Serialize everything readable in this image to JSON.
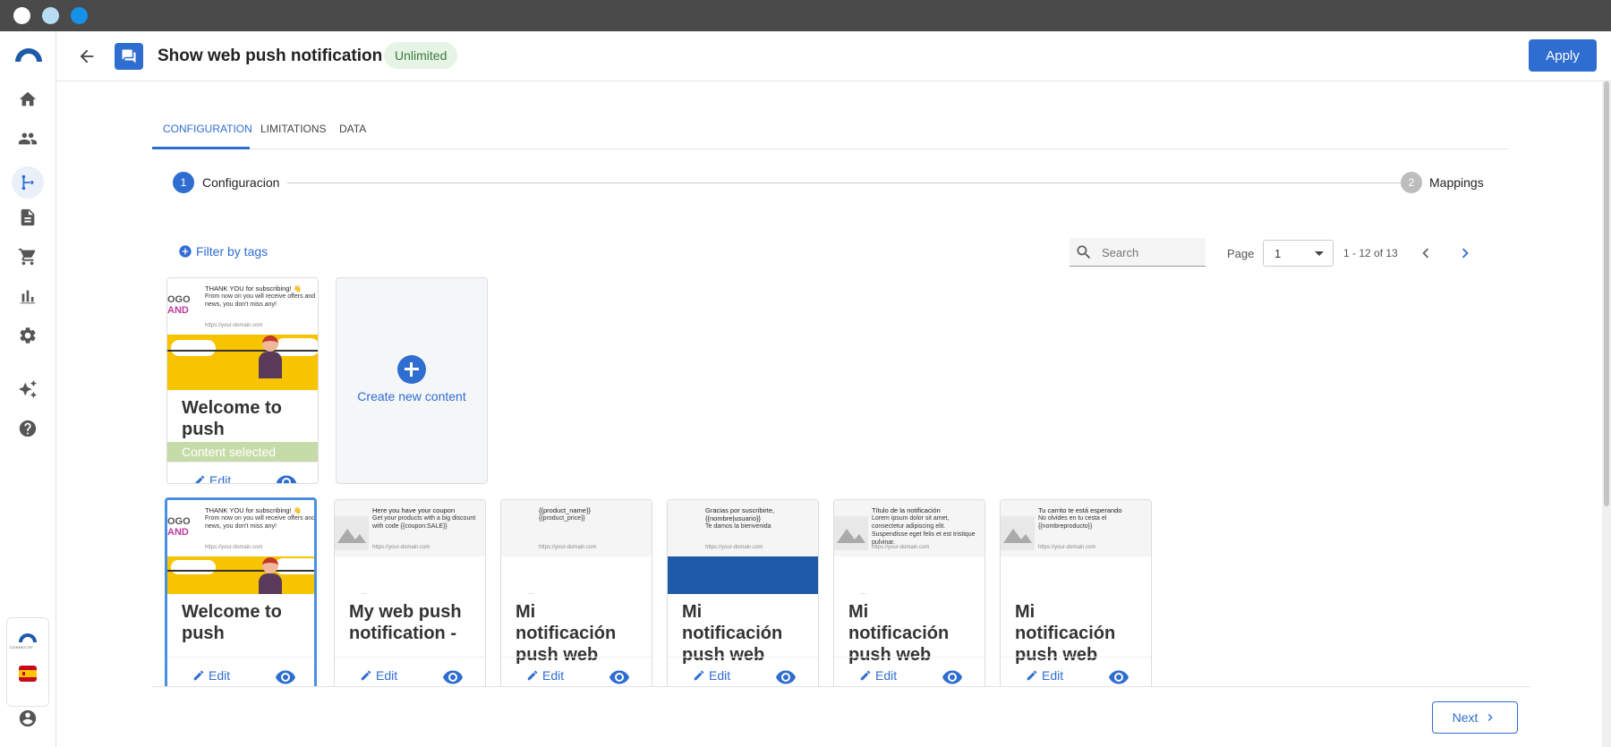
{
  "window": {
    "dots": [
      "#ffffff",
      "#b9dcf5",
      "#1591e8"
    ]
  },
  "sidebar": {
    "items": [
      "home-icon",
      "people-icon",
      "flow-icon",
      "document-icon",
      "cart-icon",
      "chart-icon",
      "gear-icon",
      "sparkle-icon",
      "help-icon"
    ],
    "active": "flow-icon",
    "brand_text": "CONNECTIF",
    "language": "es"
  },
  "header": {
    "title": "Show web push notification",
    "badge": "Unlimited",
    "apply_label": "Apply",
    "accent": "#2f6dd1"
  },
  "tabs": [
    "CONFIGURATION",
    "LIMITATIONS",
    "DATA"
  ],
  "active_tab": "CONFIGURATION",
  "stepper": {
    "steps": [
      {
        "number": "1",
        "label": "Configuracion"
      },
      {
        "number": "2",
        "label": "Mappings"
      }
    ]
  },
  "toolbar": {
    "filter_label": "Filter by tags",
    "search_placeholder": "Search",
    "page_label": "Page",
    "page_value": "1",
    "range": "1 - 12 of 13"
  },
  "selected_card": {
    "title": "Welcome to push",
    "status": "Content selected",
    "edit": "Edit",
    "thumb_title": "THANK YOU for subscribing! 👋",
    "thumb_body": "From now on you will receive offers and news, you don't miss any!",
    "thumb_url": "https://your-domain.com",
    "logo_line1": "OGO",
    "logo_line2": "AND"
  },
  "create_card": {
    "label": "Create new content"
  },
  "cards": [
    {
      "title": "Welcome to push",
      "edit": "Edit",
      "thumb_line1": "THANK YOU for subscribing! 👋",
      "thumb_line2": "From now on you will receive offers and news, you don't miss any!",
      "url": "https://your-domain.com",
      "style": "brand"
    },
    {
      "title": "My web push notification -",
      "edit": "Edit",
      "thumb_line1": "Here you have your coupon",
      "thumb_line2": "Get your products with a big discount with code {{coupon:SALE}}",
      "url": "https://your-domain.com",
      "style": "placeholder"
    },
    {
      "title": "Mi notificación push web",
      "edit": "Edit",
      "thumb_line1": "{{product_name}}",
      "thumb_line2": "{{product_price}}",
      "url": "https://your-domain.com",
      "style": "plain"
    },
    {
      "title": "Mi notificación push web",
      "edit": "Edit",
      "thumb_line1": "Gracias por suscribirte, {{nombre|usuario}}",
      "thumb_line2": "Te damos la bienvenida",
      "url": "https://your-domain.com",
      "style": "blue"
    },
    {
      "title": "Mi notificación push web",
      "edit": "Edit",
      "thumb_line1": "Título de la notificación",
      "thumb_line2": "Lorem ipsum dolor sit amet, consectetur adipiscing elit. Suspendisse eget felis et est tristique pulvinar.",
      "url": "https://your-domain.com",
      "style": "placeholder"
    },
    {
      "title": "Mi notificación push web",
      "edit": "Edit",
      "thumb_line1": "Tu carrito te está esperando",
      "thumb_line2": "No olvides en tu cesta el {{nombreproducto}}",
      "url": "https://your-domain.com",
      "style": "placeholder"
    }
  ],
  "footer": {
    "next_label": "Next"
  }
}
